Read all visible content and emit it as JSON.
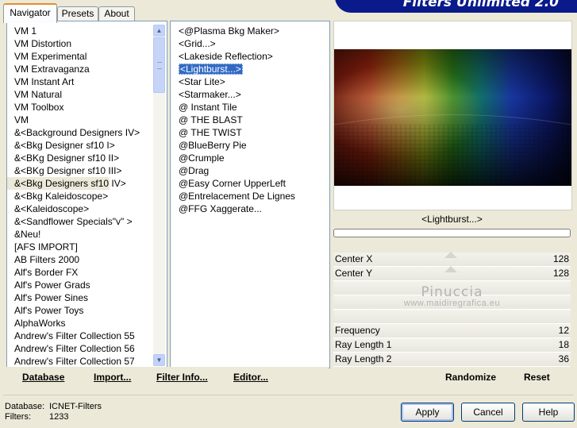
{
  "tabs": [
    "Navigator",
    "Presets",
    "About"
  ],
  "banner": {
    "title": "Filters Unlimited 2.0"
  },
  "categories": {
    "selected_index": 13,
    "items": [
      "VM 1",
      "VM Distortion",
      "VM Experimental",
      "VM Extravaganza",
      "VM Instant Art",
      "VM Natural",
      "VM Toolbox",
      "VM",
      "&<Background Designers IV>",
      "&<Bkg Designer sf10 I>",
      "&<BKg Designer sf10 II>",
      "&<BKg Designer sf10 III>",
      "&<Bkg Designers sf10 IV>",
      "&<Bkg Kaleidoscope>",
      "&<Kaleidoscope>",
      "&<Sandflower Specials\"v\" >",
      "&Neu!",
      "[AFS IMPORT]",
      "AB Filters 2000",
      "Alf's Border FX",
      "Alf's Power Grads",
      "Alf's Power Sines",
      "Alf's Power Toys",
      "AlphaWorks",
      "Andrew's Filter Collection 55",
      "Andrew's Filter Collection 56",
      "Andrew's Filter Collection 57"
    ]
  },
  "filters": {
    "selected_index": 3,
    "items": [
      "<@Plasma Bkg Maker>",
      "<Grid...>",
      "<Lakeside Reflection>",
      "<Lightburst...>",
      "<Star Lite>",
      "<Starmaker...>",
      "@ Instant Tile",
      "@ THE BLAST",
      "@ THE TWIST",
      "@BlueBerry Pie",
      "@Crumple",
      "@Drag",
      "@Easy Corner UpperLeft",
      "@Entrelacement De Lignes",
      "@FFG Xaggerate..."
    ]
  },
  "preview": {
    "filter_name": "<Lightburst...>",
    "progress": 0
  },
  "params": [
    {
      "label": "Center X",
      "value": "128",
      "slider": true
    },
    {
      "label": "Center Y",
      "value": "128",
      "slider": true
    },
    {
      "label": "",
      "value": ""
    },
    {
      "label": "",
      "value": ""
    },
    {
      "label": "",
      "value": ""
    },
    {
      "label": "Frequency",
      "value": "12"
    },
    {
      "label": "Ray Length 1",
      "value": "18"
    },
    {
      "label": "Ray Length 2",
      "value": "36"
    }
  ],
  "watermark": {
    "line1": "Pinuccia",
    "line2": "www.maidiregrafica.eu"
  },
  "toolbar": {
    "database": "Database",
    "import": "Import...",
    "filter_info": "Filter Info...",
    "editor": "Editor...",
    "randomize": "Randomize",
    "reset": "Reset"
  },
  "status": {
    "database_label": "Database:",
    "database_value": "ICNET-Filters",
    "filters_label": "Filters:",
    "filters_value": "1233"
  },
  "buttons": {
    "apply": "Apply",
    "cancel": "Cancel",
    "help": "Help"
  },
  "icons": {
    "scroll_up": "scroll-up-arrow-icon",
    "scroll_down": "scroll-down-arrow-icon"
  }
}
